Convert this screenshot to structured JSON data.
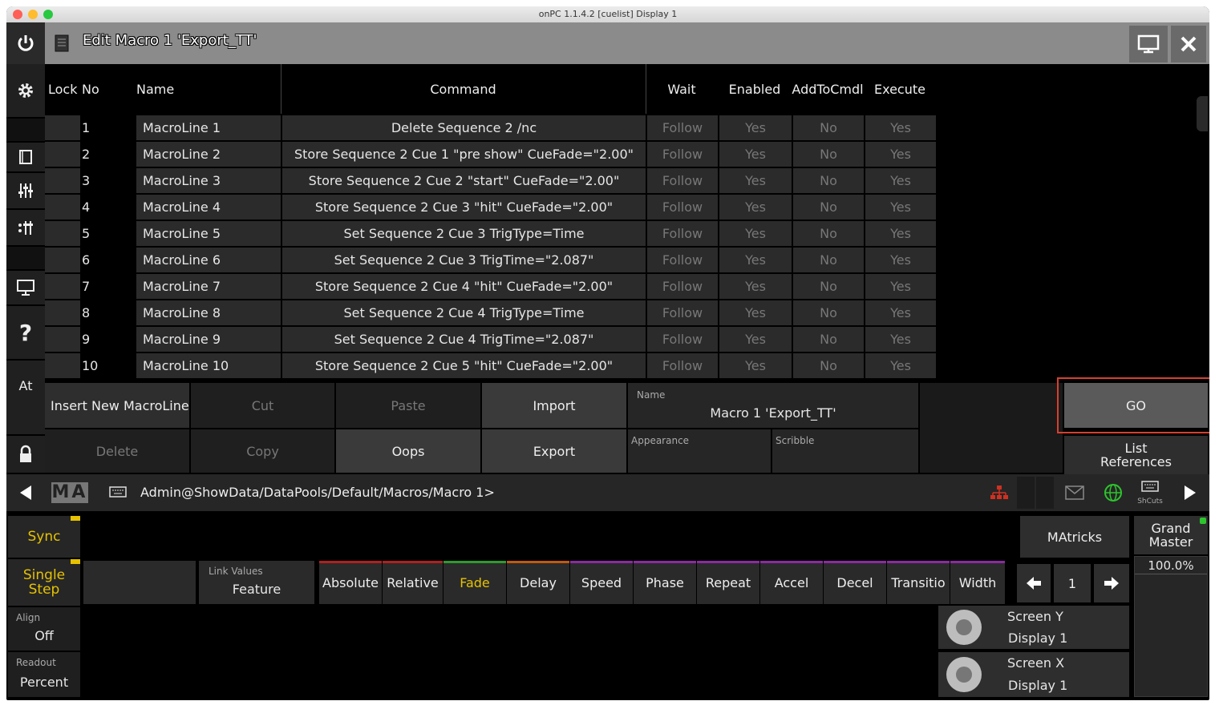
{
  "window": {
    "title": "onPC 1.1.4.2 [cuelist] Display 1"
  },
  "header": {
    "title": "Edit Macro 1 'Export_TT'",
    "power_icon": "power-icon",
    "close_icon": "close-icon"
  },
  "sidebar": {
    "at_label": "At"
  },
  "table": {
    "columns": [
      "Lock",
      "No",
      "Name",
      "Command",
      "Wait",
      "Enabled",
      "AddToCmdl",
      "Execute"
    ],
    "rows": [
      {
        "no": "1",
        "name": "MacroLine 1",
        "command": "Delete Sequence 2 /nc",
        "wait": "Follow",
        "enabled": "Yes",
        "addtocmdl": "No",
        "execute": "Yes"
      },
      {
        "no": "2",
        "name": "MacroLine 2",
        "command": "Store Sequence 2 Cue 1 \"pre show\" CueFade=\"2.00\"",
        "wait": "Follow",
        "enabled": "Yes",
        "addtocmdl": "No",
        "execute": "Yes"
      },
      {
        "no": "3",
        "name": "MacroLine 3",
        "command": "Store Sequence 2 Cue 2 \"start\" CueFade=\"2.00\"",
        "wait": "Follow",
        "enabled": "Yes",
        "addtocmdl": "No",
        "execute": "Yes"
      },
      {
        "no": "4",
        "name": "MacroLine 4",
        "command": "Store Sequence 2 Cue 3 \"hit\" CueFade=\"2.00\"",
        "wait": "Follow",
        "enabled": "Yes",
        "addtocmdl": "No",
        "execute": "Yes"
      },
      {
        "no": "5",
        "name": "MacroLine 5",
        "command": "Set Sequence 2 Cue 3 TrigType=Time",
        "wait": "Follow",
        "enabled": "Yes",
        "addtocmdl": "No",
        "execute": "Yes"
      },
      {
        "no": "6",
        "name": "MacroLine 6",
        "command": "Set Sequence 2 Cue 3 TrigTime=\"2.087\"",
        "wait": "Follow",
        "enabled": "Yes",
        "addtocmdl": "No",
        "execute": "Yes"
      },
      {
        "no": "7",
        "name": "MacroLine 7",
        "command": "Store Sequence 2 Cue 4 \"hit\" CueFade=\"2.00\"",
        "wait": "Follow",
        "enabled": "Yes",
        "addtocmdl": "No",
        "execute": "Yes"
      },
      {
        "no": "8",
        "name": "MacroLine 8",
        "command": "Set Sequence 2 Cue 4 TrigType=Time",
        "wait": "Follow",
        "enabled": "Yes",
        "addtocmdl": "No",
        "execute": "Yes"
      },
      {
        "no": "9",
        "name": "MacroLine 9",
        "command": "Set Sequence 2 Cue 4 TrigTime=\"2.087\"",
        "wait": "Follow",
        "enabled": "Yes",
        "addtocmdl": "No",
        "execute": "Yes"
      },
      {
        "no": "10",
        "name": "MacroLine 10",
        "command": "Store Sequence 2 Cue 5 \"hit\" CueFade=\"2.00\"",
        "wait": "Follow",
        "enabled": "Yes",
        "addtocmdl": "No",
        "execute": "Yes"
      }
    ]
  },
  "actions": {
    "insert": "Insert New MacroLine",
    "cut": "Cut",
    "paste": "Paste",
    "import": "Import",
    "delete": "Delete",
    "copy": "Copy",
    "oops": "Oops",
    "export": "Export",
    "go": "GO",
    "list_references": "List References",
    "name_label": "Name",
    "name_value": "Macro 1 'Export_TT'",
    "appearance_label": "Appearance",
    "scribble_label": "Scribble"
  },
  "cmdline": {
    "logo": "MA",
    "path": "Admin@ShowData/DataPools/Default/Macros/Macro 1>",
    "shcuts_label": "ShCuts"
  },
  "bottom": {
    "sync": "Sync",
    "single_step": "Single Step",
    "align_label": "Align",
    "align_value": "Off",
    "readout_label": "Readout",
    "readout_value": "Percent",
    "link_label": "Link Values",
    "link_value": "Feature",
    "presets": [
      {
        "label": "Absolute",
        "color": "#b02020"
      },
      {
        "label": "Relative",
        "color": "#b02020"
      },
      {
        "label": "Fade",
        "color": "#2e9a2e"
      },
      {
        "label": "Delay",
        "color": "#c05a10"
      },
      {
        "label": "Speed",
        "color": "#8a2aa0"
      },
      {
        "label": "Phase",
        "color": "#8a2aa0"
      },
      {
        "label": "Repeat",
        "color": "#8a2aa0"
      },
      {
        "label": "Accel",
        "color": "#8a2aa0"
      },
      {
        "label": "Decel",
        "color": "#8a2aa0"
      },
      {
        "label": "Transitio",
        "color": "#8a2aa0"
      },
      {
        "label": "Width",
        "color": "#8a2aa0"
      }
    ],
    "matricks": "MAtricks",
    "page_value": "1",
    "grand_master": "Grand Master",
    "grand_master_value": "100.0%",
    "screen_y_label": "Screen Y",
    "screen_y_value": "Display 1",
    "screen_x_label": "Screen X",
    "screen_x_value": "Display 1"
  }
}
